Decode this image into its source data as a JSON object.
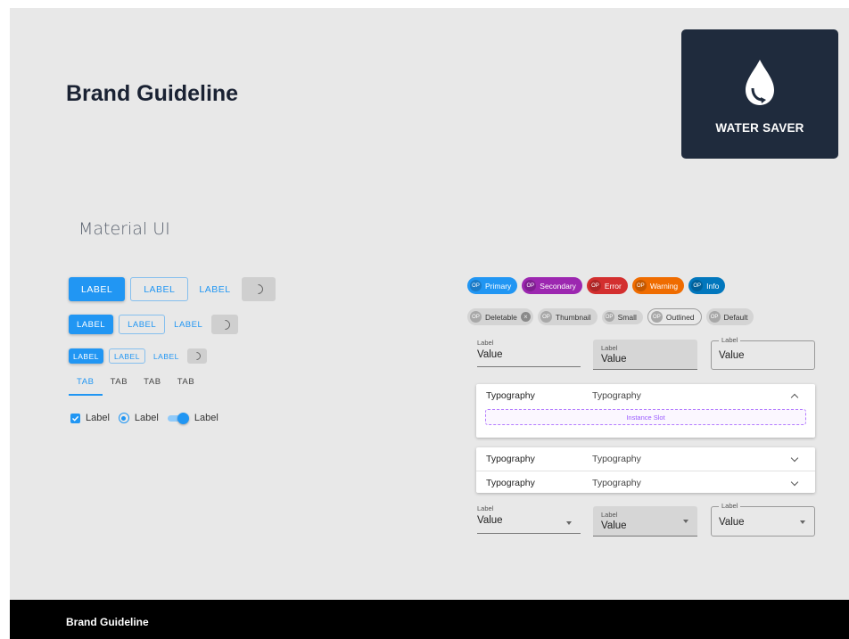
{
  "title": "Brand Guideline",
  "logo": {
    "text": "WATER SAVER"
  },
  "section_title": "Material UI",
  "buttons": {
    "label": "LABEL",
    "rows": [
      "large",
      "medium",
      "small"
    ]
  },
  "tabs": [
    "TAB",
    "TAB",
    "TAB",
    "TAB"
  ],
  "controls": {
    "checkbox_label": "Label",
    "radio_label": "Label",
    "switch_label": "Label"
  },
  "chips_row1": [
    {
      "text": "Primary",
      "variant": "primary"
    },
    {
      "text": "Secondary",
      "variant": "secondary"
    },
    {
      "text": "Error",
      "variant": "error"
    },
    {
      "text": "Warning",
      "variant": "warning"
    },
    {
      "text": "Info",
      "variant": "info"
    }
  ],
  "chips_row2": [
    {
      "text": "Deletable",
      "variant": "default"
    },
    {
      "text": "Thumbnail",
      "variant": "default"
    },
    {
      "text": "Small",
      "variant": "default"
    },
    {
      "text": "Outlined",
      "variant": "outlined"
    },
    {
      "text": "Default",
      "variant": "default"
    }
  ],
  "chip_avatar": "OP",
  "text_fields": [
    {
      "label": "Label",
      "value": "Value",
      "variant": "standard"
    },
    {
      "label": "Label",
      "value": "Value",
      "variant": "filled"
    },
    {
      "label": "Label",
      "value": "Value",
      "variant": "outlined"
    }
  ],
  "accordion_open": {
    "col1": "Typography",
    "col2": "Typography",
    "slot": "Instance Slot"
  },
  "accordion_closed": [
    {
      "col1": "Typography",
      "col2": "Typography"
    },
    {
      "col1": "Typography",
      "col2": "Typography"
    }
  ],
  "selects": [
    {
      "label": "Label",
      "value": "Value",
      "variant": "standard"
    },
    {
      "label": "Label",
      "value": "Value",
      "variant": "filled"
    },
    {
      "label": "Label",
      "value": "Value",
      "variant": "outlined"
    }
  ],
  "footer": "Brand Guideline",
  "colors": {
    "primary": "#2196f3",
    "secondary": "#9c27b0",
    "error": "#d32f2f",
    "warning": "#ef6c00",
    "info": "#0277bd",
    "logo_bg": "#1f2b3d",
    "page_bg": "#e8e8e8"
  }
}
